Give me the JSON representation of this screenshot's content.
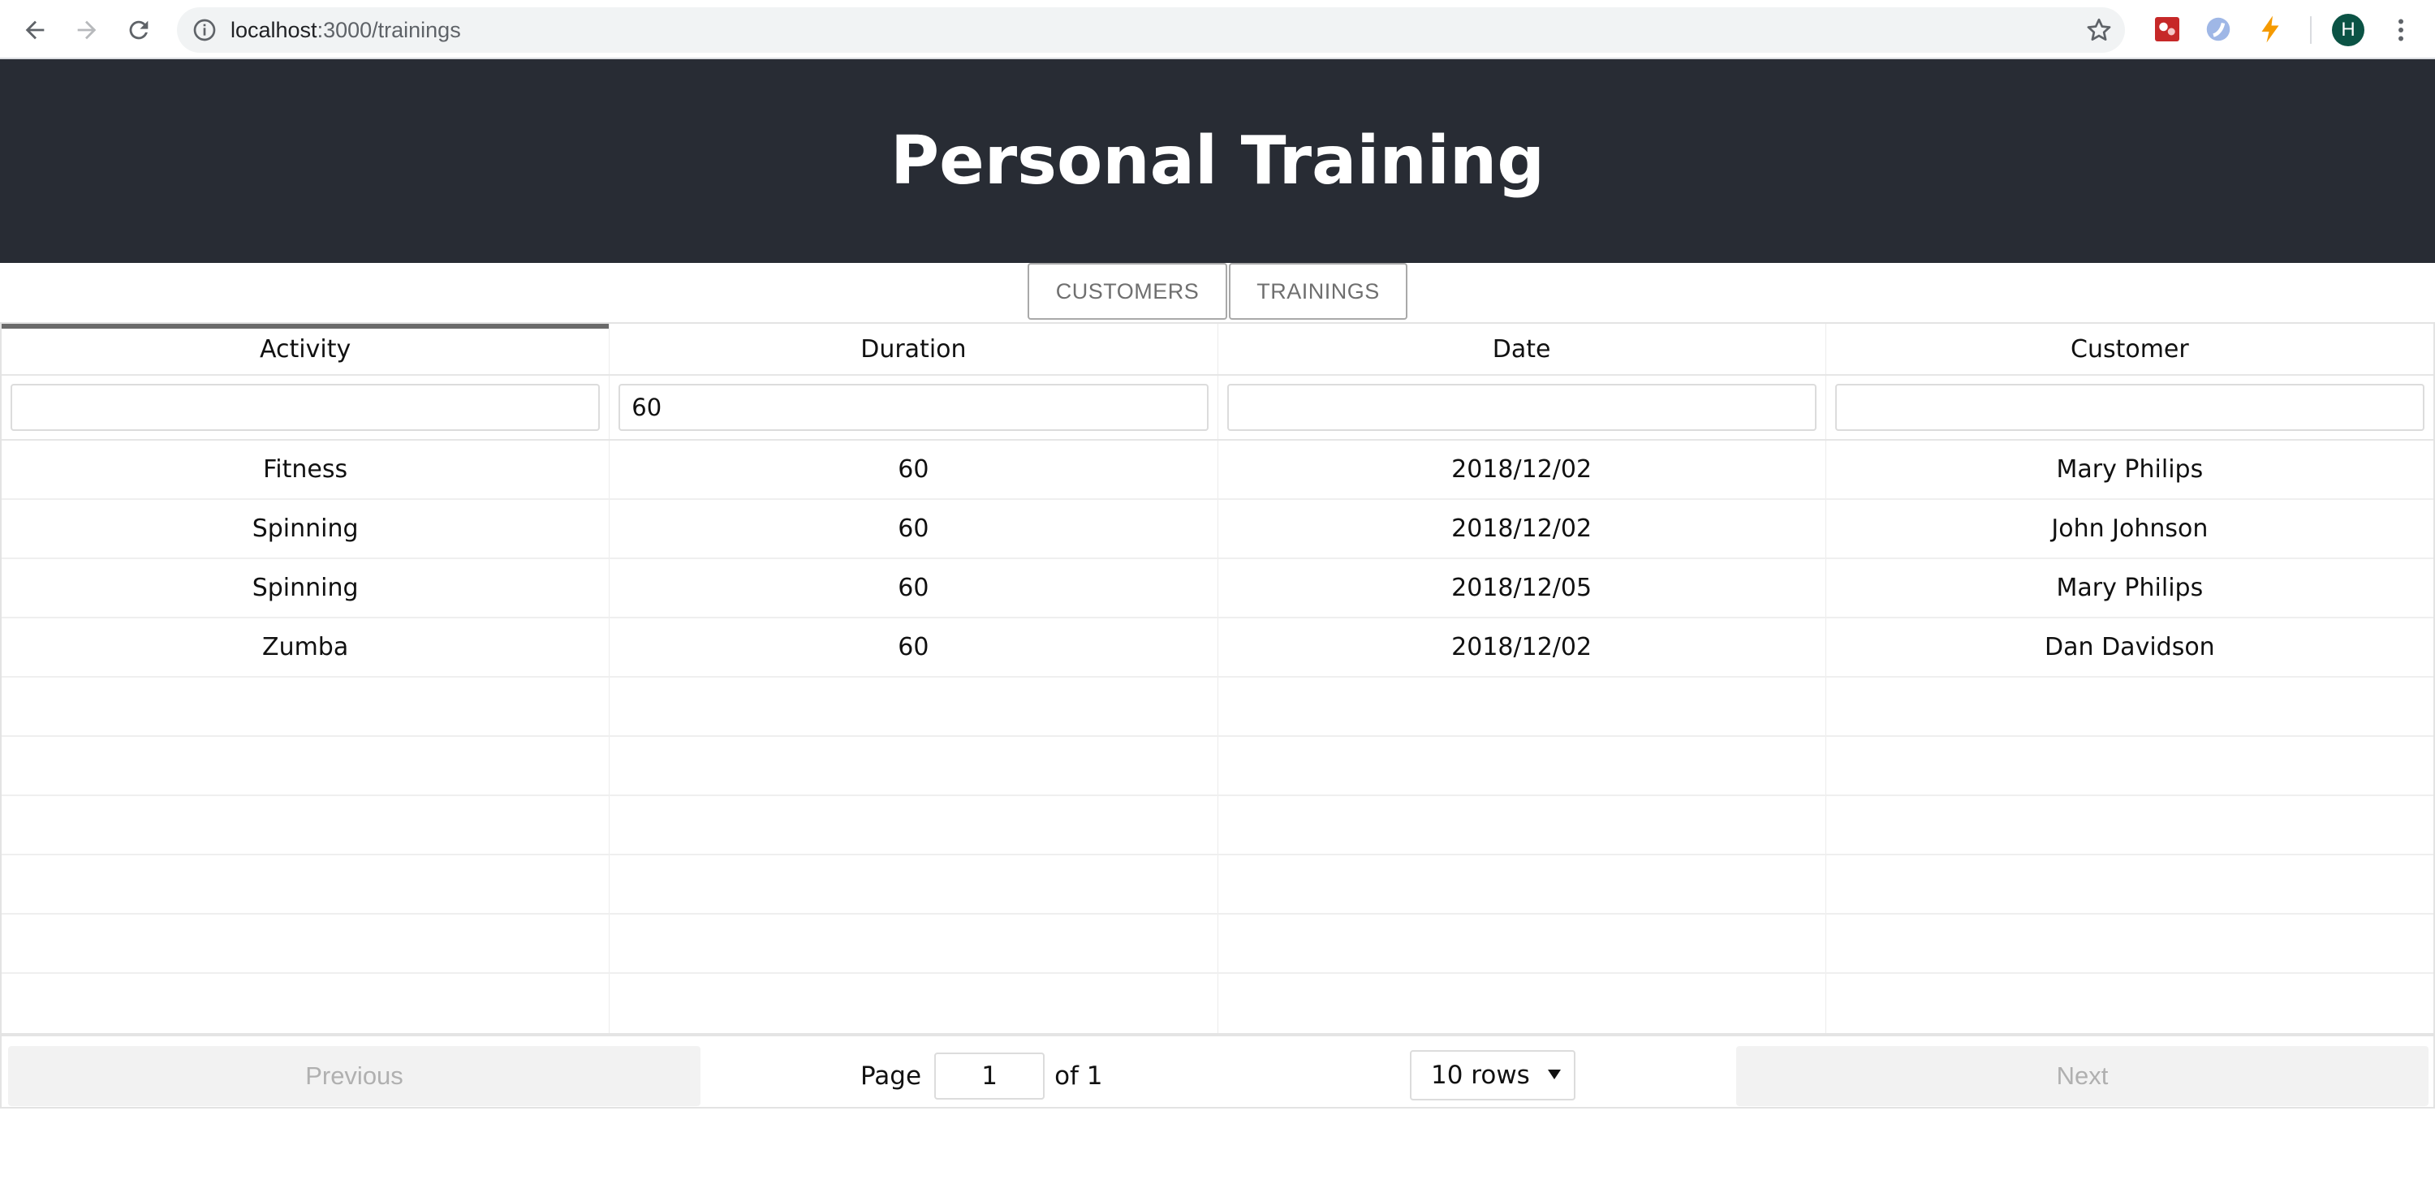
{
  "browser": {
    "url_host": "localhost",
    "url_path": ":3000/trainings",
    "profile_initial": "H"
  },
  "header": {
    "title": "Personal Training"
  },
  "tabs": [
    {
      "label": "CUSTOMERS"
    },
    {
      "label": "TRAININGS"
    }
  ],
  "table": {
    "columns": [
      "Activity",
      "Duration",
      "Date",
      "Customer"
    ],
    "filters": [
      "",
      "60",
      "",
      ""
    ],
    "rows": [
      [
        "Fitness",
        "60",
        "2018/12/02",
        "Mary Philips"
      ],
      [
        "Spinning",
        "60",
        "2018/12/02",
        "John Johnson"
      ],
      [
        "Spinning",
        "60",
        "2018/12/05",
        "Mary Philips"
      ],
      [
        "Zumba",
        "60",
        "2018/12/02",
        "Dan Davidson"
      ],
      [
        "",
        "",
        "",
        ""
      ],
      [
        "",
        "",
        "",
        ""
      ],
      [
        "",
        "",
        "",
        ""
      ],
      [
        "",
        "",
        "",
        ""
      ],
      [
        "",
        "",
        "",
        ""
      ],
      [
        "",
        "",
        "",
        ""
      ]
    ]
  },
  "pagination": {
    "previous_label": "Previous",
    "next_label": "Next",
    "page_label": "Page",
    "current_page": "1",
    "of_label": "of 1",
    "rows_option": "10 rows"
  },
  "colors": {
    "header_bg": "#282c34",
    "header_text": "#ffffff",
    "avatar_bg": "#0b5345"
  }
}
